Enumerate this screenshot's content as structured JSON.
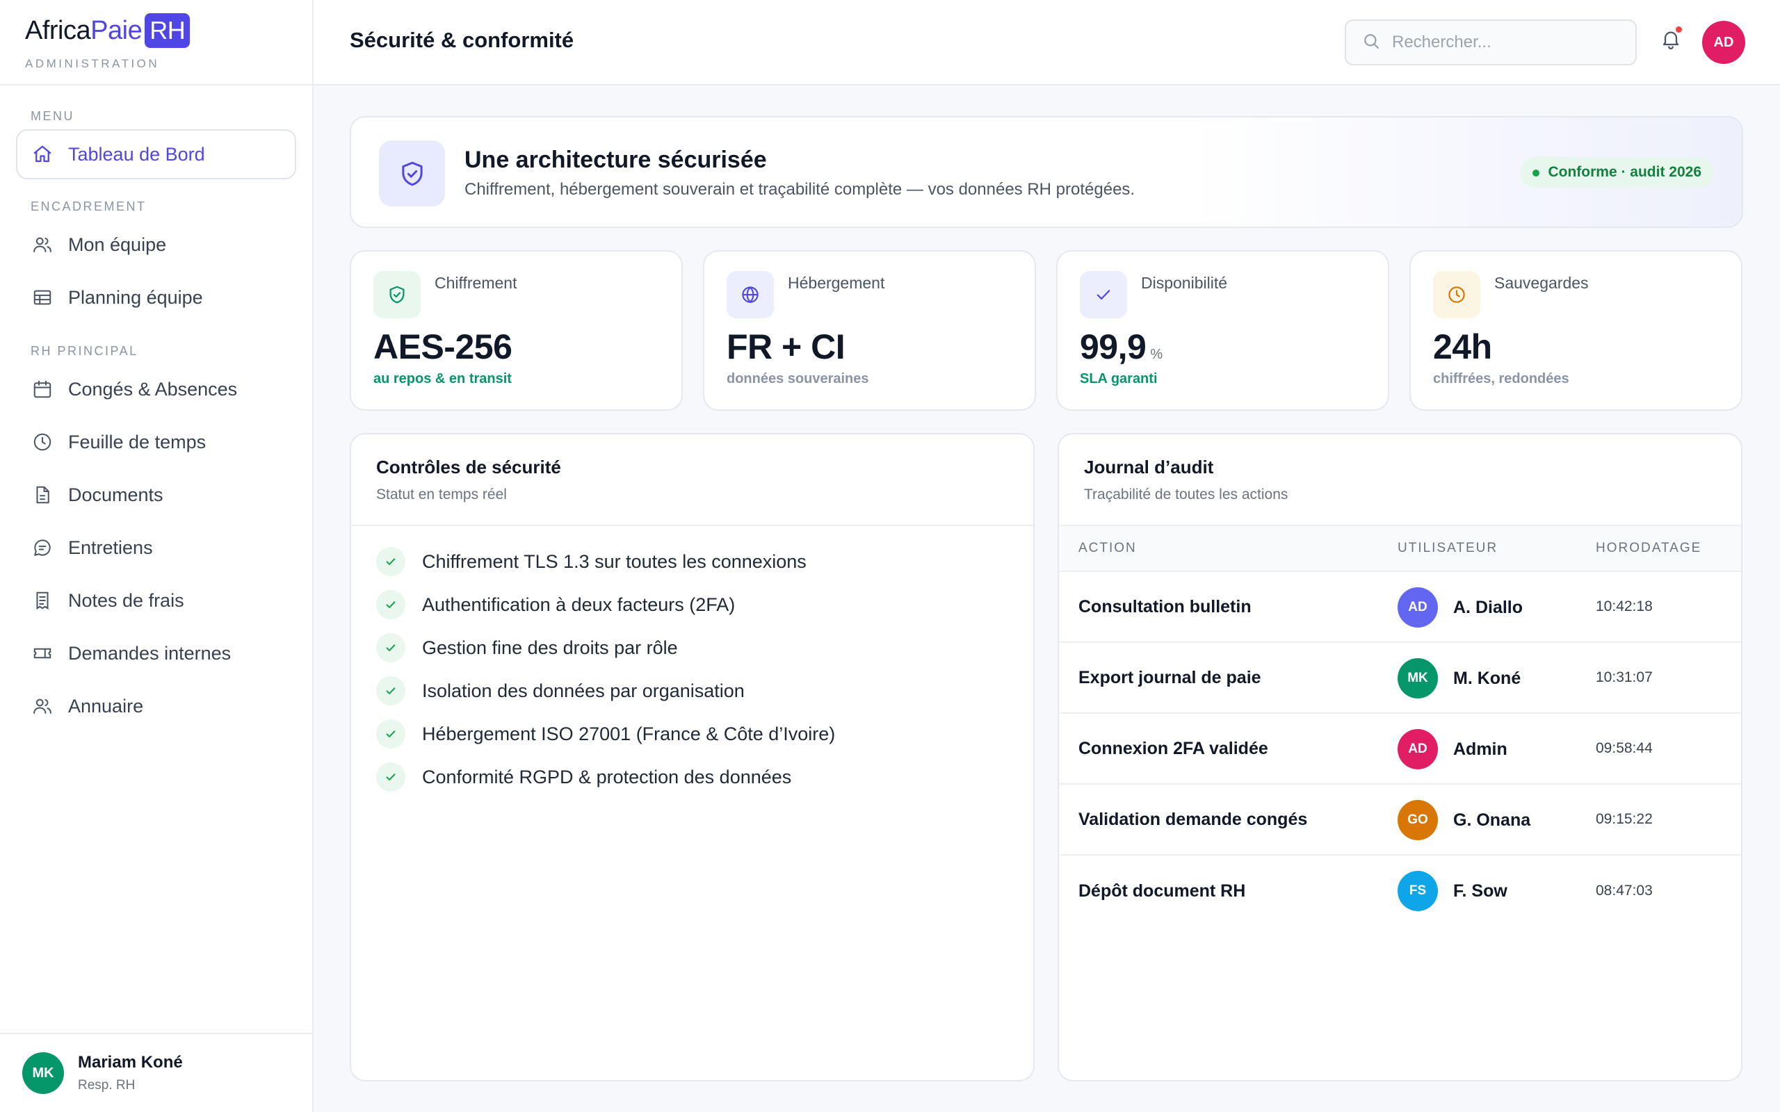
{
  "brand": {
    "part1": "Africa",
    "part2": "Paie",
    "part3": "RH",
    "subtitle": "ADMINISTRATION"
  },
  "sidebar": {
    "sections": [
      {
        "label": "MENU",
        "items": [
          {
            "label": "Tableau de Bord",
            "icon": "home-icon",
            "active": true
          }
        ]
      },
      {
        "label": "ENCADREMENT",
        "items": [
          {
            "label": "Mon équipe",
            "icon": "users-icon"
          },
          {
            "label": "Planning équipe",
            "icon": "table-icon"
          }
        ]
      },
      {
        "label": "RH PRINCIPAL",
        "items": [
          {
            "label": "Congés & Absences",
            "icon": "calendar-icon"
          },
          {
            "label": "Feuille de temps",
            "icon": "clock-icon"
          },
          {
            "label": "Documents",
            "icon": "document-icon"
          },
          {
            "label": "Entretiens",
            "icon": "chat-icon"
          },
          {
            "label": "Notes de frais",
            "icon": "receipt-icon"
          },
          {
            "label": "Demandes internes",
            "icon": "ticket-icon"
          },
          {
            "label": "Annuaire",
            "icon": "users-icon"
          }
        ]
      }
    ],
    "user": {
      "initials": "MK",
      "name": "Mariam Koné",
      "role": "Resp. RH",
      "color": "#059669"
    }
  },
  "header": {
    "title": "Sécurité & conformité",
    "search_placeholder": "Rechercher...",
    "avatar_initials": "AD",
    "avatar_color": "#e11d63"
  },
  "banner": {
    "title": "Une architecture sécurisée",
    "subtitle": "Chiffrement, hébergement souverain et traçabilité complète — vos données RH protégées.",
    "badge": "Conforme · audit 2026"
  },
  "stats": [
    {
      "label": "Chiffrement",
      "value": "AES-256",
      "unit": "",
      "note": "au repos & en transit",
      "note_color": "#059669",
      "icon": "shield-icon",
      "icon_bg": "#e9f7ef",
      "icon_color": "#059669"
    },
    {
      "label": "Hébergement",
      "value": "FR + CI",
      "unit": "",
      "note": "données souveraines",
      "note_color": "#8a94a6",
      "icon": "globe-icon",
      "icon_bg": "#eceefd",
      "icon_color": "#4f46e5"
    },
    {
      "label": "Disponibilité",
      "value": "99,9",
      "unit": "%",
      "note": "SLA garanti",
      "note_color": "#059669",
      "icon": "check-icon",
      "icon_bg": "#eceefd",
      "icon_color": "#4f46e5"
    },
    {
      "label": "Sauvegardes",
      "value": "24h",
      "unit": "",
      "note": "chiffrées, redondées",
      "note_color": "#8a94a6",
      "icon": "clock-icon",
      "icon_bg": "#fdf5e3",
      "icon_color": "#d97706"
    }
  ],
  "controls_panel": {
    "title": "Contrôles de sécurité",
    "subtitle": "Statut en temps réel",
    "items": [
      "Chiffrement TLS 1.3 sur toutes les connexions",
      "Authentification à deux facteurs (2FA)",
      "Gestion fine des droits par rôle",
      "Isolation des données par organisation",
      "Hébergement ISO 27001 (France & Côte d’Ivoire)",
      "Conformité RGPD & protection des données"
    ]
  },
  "audit_panel": {
    "title": "Journal d’audit",
    "subtitle": "Traçabilité de toutes les actions",
    "columns": [
      "ACTION",
      "UTILISATEUR",
      "HORODATAGE"
    ],
    "rows": [
      {
        "action": "Consultation bulletin",
        "initials": "AD",
        "user": "A. Diallo",
        "time": "10:42:18",
        "color": "#6366f1"
      },
      {
        "action": "Export journal de paie",
        "initials": "MK",
        "user": "M. Koné",
        "time": "10:31:07",
        "color": "#059669"
      },
      {
        "action": "Connexion 2FA validée",
        "initials": "AD",
        "user": "Admin",
        "time": "09:58:44",
        "color": "#e11d63"
      },
      {
        "action": "Validation demande congés",
        "initials": "GO",
        "user": "G. Onana",
        "time": "09:15:22",
        "color": "#d97706"
      },
      {
        "action": "Dépôt document RH",
        "initials": "FS",
        "user": "F. Sow",
        "time": "08:47:03",
        "color": "#0ea5e9"
      }
    ]
  }
}
